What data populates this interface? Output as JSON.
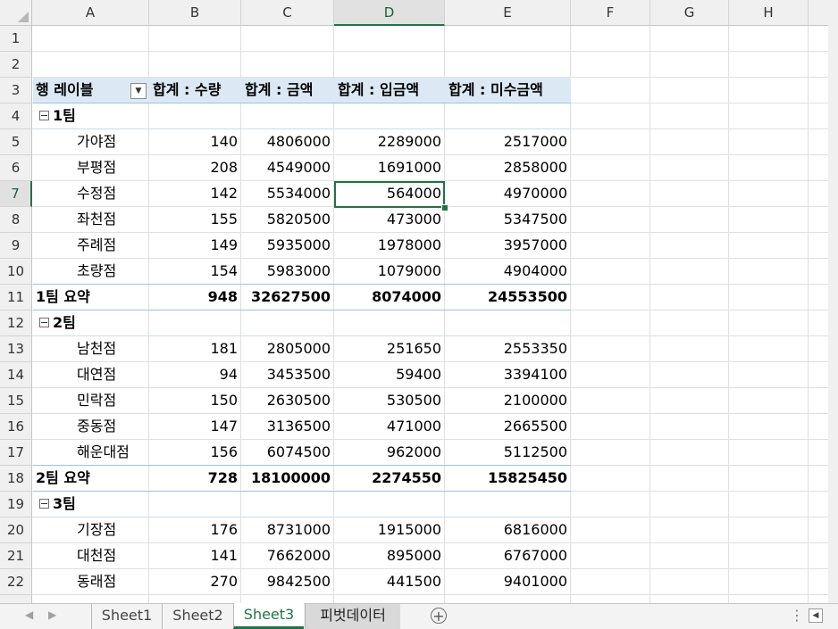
{
  "columns": [
    "A",
    "B",
    "C",
    "D",
    "E",
    "F",
    "G",
    "H"
  ],
  "selected_column": "D",
  "selected_row": "7",
  "rows_numbers": [
    "1",
    "2",
    "3",
    "4",
    "5",
    "6",
    "7",
    "8",
    "9",
    "10",
    "11",
    "12",
    "13",
    "14",
    "15",
    "16",
    "17",
    "18",
    "19",
    "20",
    "21",
    "22"
  ],
  "pivot": {
    "headers": [
      "행 레이블",
      "합계 : 수량",
      "합계 : 금액",
      "합계 : 입금액",
      "합계 : 미수금액"
    ],
    "groups": [
      {
        "name": "1팀",
        "rows": [
          {
            "label": "가야점",
            "qty": "140",
            "amount": "4806000",
            "paid": "2289000",
            "unpaid": "2517000"
          },
          {
            "label": "부평점",
            "qty": "208",
            "amount": "4549000",
            "paid": "1691000",
            "unpaid": "2858000"
          },
          {
            "label": "수정점",
            "qty": "142",
            "amount": "5534000",
            "paid": "564000",
            "unpaid": "4970000"
          },
          {
            "label": "좌천점",
            "qty": "155",
            "amount": "5820500",
            "paid": "473000",
            "unpaid": "5347500"
          },
          {
            "label": "주례점",
            "qty": "149",
            "amount": "5935000",
            "paid": "1978000",
            "unpaid": "3957000"
          },
          {
            "label": "초량점",
            "qty": "154",
            "amount": "5983000",
            "paid": "1079000",
            "unpaid": "4904000"
          }
        ],
        "summary": {
          "label": "1팀 요약",
          "qty": "948",
          "amount": "32627500",
          "paid": "8074000",
          "unpaid": "24553500"
        }
      },
      {
        "name": "2팀",
        "rows": [
          {
            "label": "남천점",
            "qty": "181",
            "amount": "2805000",
            "paid": "251650",
            "unpaid": "2553350"
          },
          {
            "label": "대연점",
            "qty": "94",
            "amount": "3453500",
            "paid": "59400",
            "unpaid": "3394100"
          },
          {
            "label": "민락점",
            "qty": "150",
            "amount": "2630500",
            "paid": "530500",
            "unpaid": "2100000"
          },
          {
            "label": "중동점",
            "qty": "147",
            "amount": "3136500",
            "paid": "471000",
            "unpaid": "2665500"
          },
          {
            "label": "해운대점",
            "qty": "156",
            "amount": "6074500",
            "paid": "962000",
            "unpaid": "5112500"
          }
        ],
        "summary": {
          "label": "2팀 요약",
          "qty": "728",
          "amount": "18100000",
          "paid": "2274550",
          "unpaid": "15825450"
        }
      },
      {
        "name": "3팀",
        "rows": [
          {
            "label": "기장점",
            "qty": "176",
            "amount": "8731000",
            "paid": "1915000",
            "unpaid": "6816000"
          },
          {
            "label": "대천점",
            "qty": "141",
            "amount": "7662000",
            "paid": "895000",
            "unpaid": "6767000"
          },
          {
            "label": "동래점",
            "qty": "270",
            "amount": "9842500",
            "paid": "441500",
            "unpaid": "9401000"
          }
        ]
      }
    ]
  },
  "sheet_tabs": [
    "Sheet1",
    "Sheet2",
    "Sheet3",
    "피벗데이터"
  ],
  "active_tab": "Sheet3",
  "icons": {
    "add_sheet": "plus-circle-icon",
    "scroll_left": "triangle-left-icon",
    "options": "vertical-dots-icon"
  },
  "colors": {
    "accent": "#217346",
    "pivot_header": "#dce9f5",
    "pivot_line": "#9bc2e6"
  }
}
